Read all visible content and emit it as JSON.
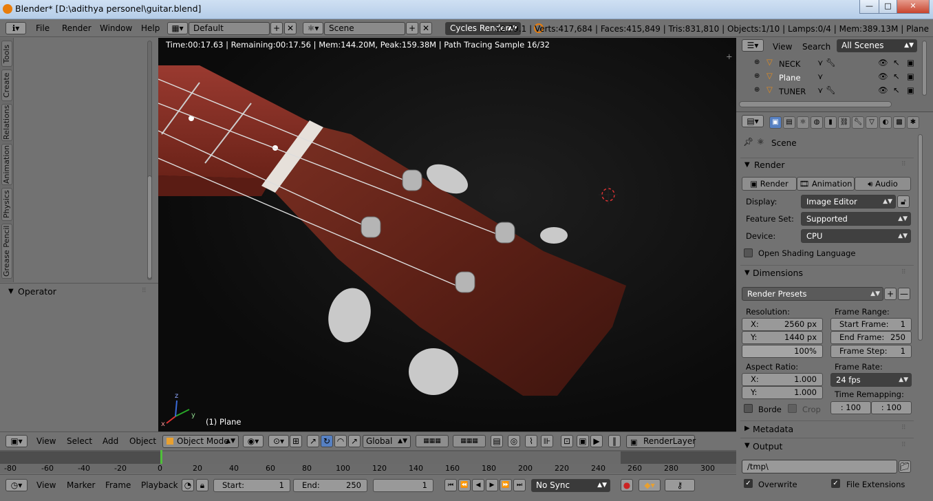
{
  "window": {
    "title": "Blender* [D:\\adithya personel\\guitar.blend]",
    "min": "—",
    "max": "□",
    "close": "✕"
  },
  "info_header": {
    "menus": [
      "File",
      "Render",
      "Window",
      "Help"
    ],
    "layout": "Default",
    "scene": "Scene",
    "engine": "Cycles Render",
    "stats": "v2.79.1 | Verts:417,684 | Faces:415,849 | Tris:831,810 | Objects:1/10 | Lamps:0/4 | Mem:389.13M | Plane"
  },
  "left_tabs": [
    "Tools",
    "Create",
    "Relations",
    "Animation",
    "Physics",
    "Grease Pencil"
  ],
  "operator_panel": {
    "title": "Operator"
  },
  "viewport": {
    "render_info": "Time:00:17.63 | Remaining:00:17.56 | Mem:144.20M, Peak:159.38M | Path Tracing Sample 16/32",
    "object_label": "(1) Plane",
    "axis_x": "x",
    "axis_y": "y",
    "axis_z": "z"
  },
  "view3d_header": {
    "menus": [
      "View",
      "Select",
      "Add",
      "Object"
    ],
    "mode": "Object Mode",
    "orientation": "Global",
    "render_layer": "RenderLayer"
  },
  "timeline": {
    "ticks": [
      "-80",
      "-60",
      "-40",
      "-20",
      "0",
      "20",
      "40",
      "60",
      "80",
      "100",
      "120",
      "140",
      "160",
      "180",
      "200",
      "220",
      "240",
      "260",
      "280",
      "300"
    ],
    "menus": [
      "View",
      "Marker",
      "Frame",
      "Playback"
    ],
    "start_label": "Start:",
    "start": "1",
    "end_label": "End:",
    "end": "250",
    "current": "1",
    "sync": "No Sync"
  },
  "outliner": {
    "menus": [
      "View",
      "Search"
    ],
    "filter": "All Scenes",
    "rows": [
      "NECK",
      "Plane",
      "TUNER"
    ]
  },
  "properties": {
    "context": "Scene",
    "render_section": "Render",
    "render_buttons": [
      "Render",
      "Animation",
      "Audio"
    ],
    "display_label": "Display:",
    "display": "Image Editor",
    "feature_label": "Feature Set:",
    "feature": "Supported",
    "device_label": "Device:",
    "device": "CPU",
    "osl": "Open Shading Language",
    "dimensions_section": "Dimensions",
    "presets": "Render Presets",
    "resolution_label": "Resolution:",
    "res_x_label": "X:",
    "res_x": "2560 px",
    "res_y_label": "Y:",
    "res_y": "1440 px",
    "res_pct": "100%",
    "frame_range_label": "Frame Range:",
    "start_frame_label": "Start Frame:",
    "start_frame": "1",
    "end_frame_label": "End Frame:",
    "end_frame": "250",
    "frame_step_label": "Frame Step:",
    "frame_step": "1",
    "aspect_label": "Aspect Ratio:",
    "asp_x_label": "X:",
    "asp_x": "1.000",
    "asp_y_label": "Y:",
    "asp_y": "1.000",
    "frame_rate_label": "Frame Rate:",
    "frame_rate": "24 fps",
    "border": "Borde",
    "crop": "Crop",
    "remap_label": "Time Remapping:",
    "remap_old": ": 100",
    "remap_new": ": 100",
    "metadata_section": "Metadata",
    "output_section": "Output",
    "output_path": "/tmp\\",
    "overwrite": "Overwrite",
    "file_ext": "File Extensions"
  }
}
